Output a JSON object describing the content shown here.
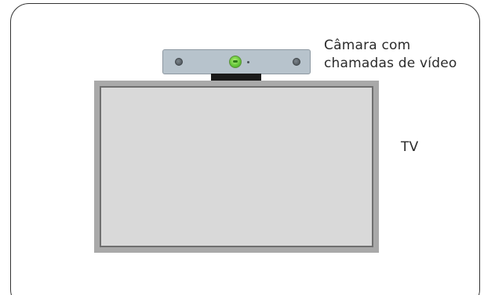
{
  "labels": {
    "camera_line1": "Câmara com",
    "camera_line2": "chamadas de vídeo",
    "tv": "TV"
  },
  "colors": {
    "camera_body": "#b7c3cc",
    "camera_lens": "#66c83a",
    "camera_mount": "#1a1a1a",
    "tv_bezel": "#a9a9a9",
    "tv_screen": "#d9d9d9",
    "frame_border": "#333333"
  }
}
